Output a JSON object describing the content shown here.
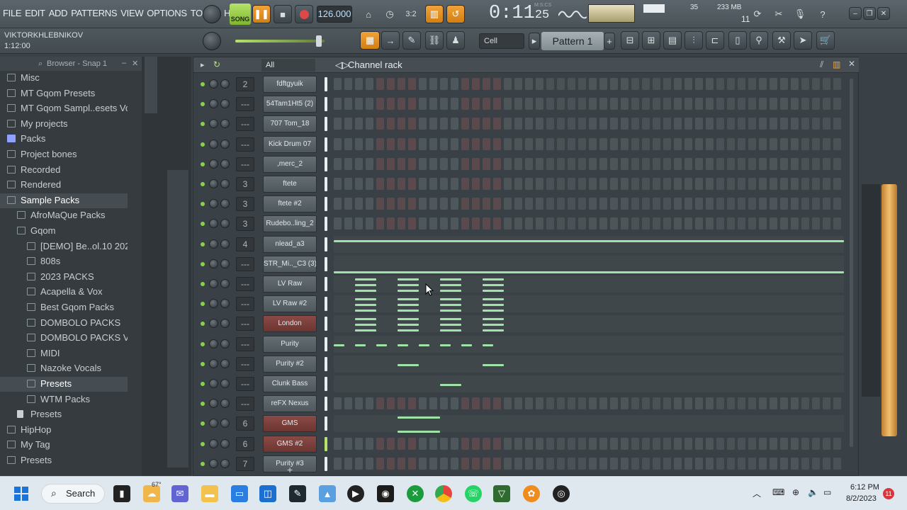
{
  "menu": [
    "FILE",
    "EDIT",
    "ADD",
    "PATTERNS",
    "VIEW",
    "OPTIONS",
    "TOOLS",
    "HELP"
  ],
  "transport": {
    "song_label": "SONG",
    "tempo": "126.000",
    "time": "0:11",
    "time_sub": "25",
    "time_unit_label": "M:S:CS"
  },
  "perf": {
    "cpu": "35",
    "mem": "233 MB",
    "voices": "11"
  },
  "user": {
    "name": "VIKTORKHLEBNIKOV",
    "time": "1:12:00"
  },
  "snap": "Cell",
  "pattern": "Pattern 1",
  "browser": {
    "title": "Browser - Snap 1",
    "items": [
      {
        "label": "Misc",
        "indent": 0,
        "type": "folder"
      },
      {
        "label": "MT Gqom Presets",
        "indent": 0,
        "type": "folder"
      },
      {
        "label": "MT Gqom Sampl..esets Vol 1",
        "indent": 0,
        "type": "folder"
      },
      {
        "label": "My projects",
        "indent": 0,
        "type": "folder"
      },
      {
        "label": "Packs",
        "indent": 0,
        "type": "pack"
      },
      {
        "label": "Project bones",
        "indent": 0,
        "type": "folder"
      },
      {
        "label": "Recorded",
        "indent": 0,
        "type": "plus"
      },
      {
        "label": "Rendered",
        "indent": 0,
        "type": "plus"
      },
      {
        "label": "Sample Packs",
        "indent": 0,
        "type": "folder",
        "selected": true
      },
      {
        "label": "AfroMaQue Packs",
        "indent": 1,
        "type": "folder"
      },
      {
        "label": "Gqom",
        "indent": 1,
        "type": "folder"
      },
      {
        "label": "[DEMO] Be..ol.10 2023",
        "indent": 2,
        "type": "folder"
      },
      {
        "label": "808s",
        "indent": 2,
        "type": "folder"
      },
      {
        "label": "2023 PACKS",
        "indent": 2,
        "type": "folder"
      },
      {
        "label": "Acapella & Vox",
        "indent": 2,
        "type": "folder"
      },
      {
        "label": "Best Gqom Packs",
        "indent": 2,
        "type": "folder"
      },
      {
        "label": "DOMBOLO PACKS",
        "indent": 2,
        "type": "folder"
      },
      {
        "label": "DOMBOLO PACKS VOL 2",
        "indent": 2,
        "type": "folder"
      },
      {
        "label": "MIDI",
        "indent": 2,
        "type": "folder"
      },
      {
        "label": "Nazoke Vocals",
        "indent": 2,
        "type": "folder"
      },
      {
        "label": "Presets",
        "indent": 2,
        "type": "folder",
        "selected": true
      },
      {
        "label": "WTM Packs",
        "indent": 2,
        "type": "folder"
      },
      {
        "label": "Presets",
        "indent": 1,
        "type": "file"
      },
      {
        "label": "HipHop",
        "indent": 0,
        "type": "folder"
      },
      {
        "label": "My Tag",
        "indent": 0,
        "type": "folder"
      },
      {
        "label": "Presets",
        "indent": 0,
        "type": "folder"
      }
    ]
  },
  "rack": {
    "title": "Channel rack",
    "filter": "All",
    "channels": [
      {
        "num": "2",
        "name": "fdftgyuik",
        "kind": "steps",
        "red": false
      },
      {
        "num": "---",
        "name": "54Tam1Ht5 (2)",
        "kind": "steps",
        "red": false
      },
      {
        "num": "---",
        "name": "707 Tom_18",
        "kind": "steps",
        "red": false
      },
      {
        "num": "---",
        "name": "Kick Drum 07",
        "kind": "steps",
        "red": false
      },
      {
        "num": "---",
        "name": ",merc_2",
        "kind": "steps",
        "red": false
      },
      {
        "num": "3",
        "name": "ftete",
        "kind": "steps",
        "red": false
      },
      {
        "num": "3",
        "name": "ftete #2",
        "kind": "steps",
        "red": false
      },
      {
        "num": "3",
        "name": "Rudebo..ling_2",
        "kind": "steps",
        "red": false
      },
      {
        "num": "4",
        "name": "nlead_a3",
        "kind": "roll",
        "red": false
      },
      {
        "num": "---",
        "name": "STR_Mi.._C3 (3)",
        "kind": "roll",
        "red": false
      },
      {
        "num": "---",
        "name": "LV Raw",
        "kind": "roll",
        "red": false
      },
      {
        "num": "---",
        "name": "LV Raw #2",
        "kind": "roll",
        "red": false
      },
      {
        "num": "---",
        "name": "London",
        "kind": "roll",
        "red": true
      },
      {
        "num": "---",
        "name": "Purity",
        "kind": "roll",
        "red": false
      },
      {
        "num": "---",
        "name": "Purity #2",
        "kind": "roll",
        "red": false
      },
      {
        "num": "---",
        "name": "Clunk Bass",
        "kind": "roll",
        "red": false
      },
      {
        "num": "---",
        "name": "reFX Nexus",
        "kind": "steps",
        "red": false
      },
      {
        "num": "6",
        "name": "GMS",
        "kind": "roll",
        "red": true
      },
      {
        "num": "6",
        "name": "GMS #2",
        "kind": "steps",
        "red": true
      },
      {
        "num": "7",
        "name": "Purity #3",
        "kind": "steps",
        "red": false
      }
    ]
  },
  "taskbar": {
    "search": "Search",
    "weather": "67°",
    "time": "6:12 PM",
    "date": "8/2/2023",
    "notif": "11"
  }
}
